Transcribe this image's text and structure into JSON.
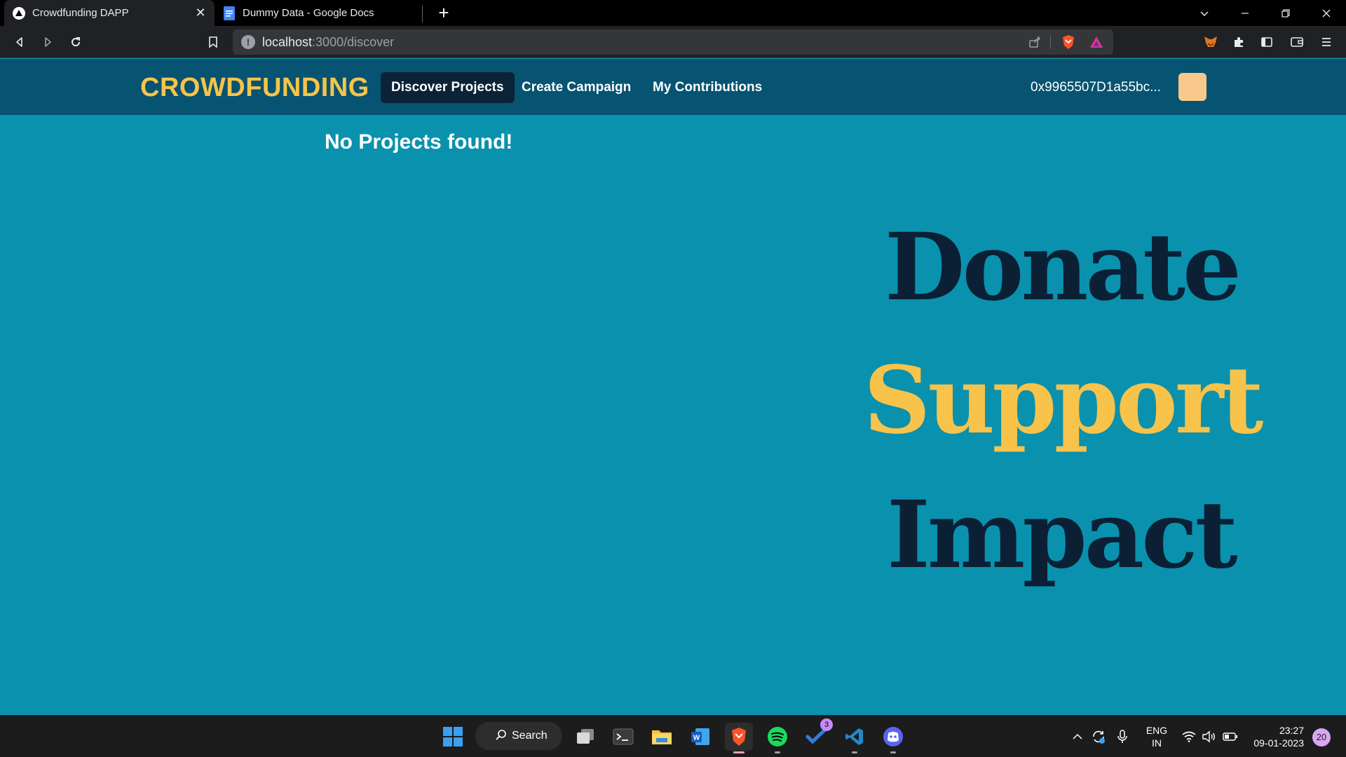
{
  "browser": {
    "tabs": [
      {
        "title": "Crowdfunding DAPP",
        "icon": "vercel-triangle-icon",
        "active": true
      },
      {
        "title": "Dummy Data - Google Docs",
        "icon": "google-docs-icon",
        "active": false
      }
    ],
    "address": {
      "host": "localhost",
      "path": ":3000/discover"
    }
  },
  "app": {
    "brand": "CROWDFUNDING",
    "nav": [
      {
        "label": "Discover Projects",
        "active": true
      },
      {
        "label": "Create Campaign",
        "active": false
      },
      {
        "label": "My Contributions",
        "active": false
      }
    ],
    "wallet_address": "0x9965507D1a55bc...",
    "avatar_color": "#f8c98a",
    "empty_message": "No Projects found!",
    "hero": {
      "line1": "Donate",
      "line2": "Support",
      "line3": "Impact"
    },
    "colors": {
      "accent": "#f7c34a",
      "nav_bg": "#075372",
      "page_bg": "#0a91ae",
      "dark": "#0b2035"
    }
  },
  "taskbar": {
    "search_label": "Search",
    "todo_badge": "3",
    "lang": {
      "line1": "ENG",
      "line2": "IN"
    },
    "time": "23:27",
    "date": "09-01-2023",
    "notification_count": "20"
  }
}
